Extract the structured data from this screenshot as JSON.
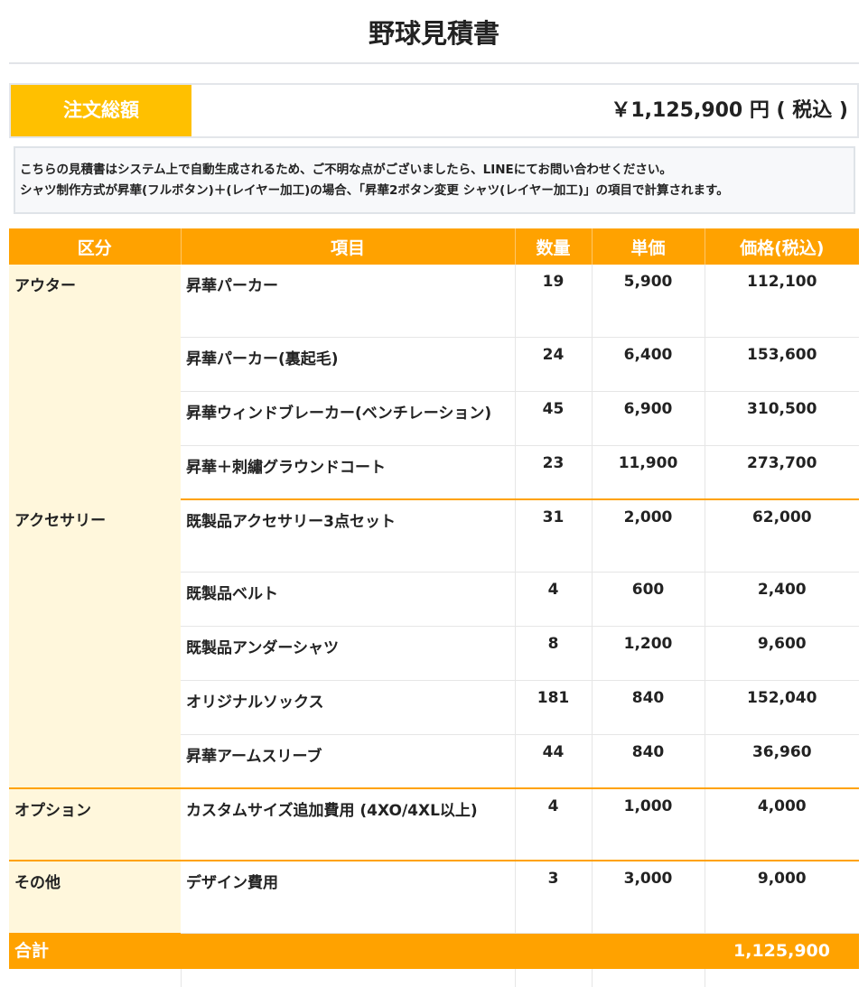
{
  "title": "野球見積書",
  "order_total": {
    "label": "注文総額",
    "value": "￥1,125,900 円 ( 税込 )"
  },
  "notice": {
    "line1": "こちらの見積書はシステム上で自動生成されるため、ご不明な点がございましたら、LINEにてお問い合わせください。",
    "line2": "シャツ制作方式が昇華(フルボタン)＋(レイヤー加工)の場合、「昇華2ボタン変更 シャツ(レイヤー加工)」の項目で計算されます。"
  },
  "table": {
    "headers": [
      "区分",
      "項目",
      "数量",
      "単価",
      "価格(税込)"
    ],
    "groups": [
      {
        "category": "アウター",
        "rows": [
          {
            "item": "昇華パーカー",
            "qty": "19",
            "unit": "5,900",
            "price": "112,100"
          },
          {
            "item": "昇華パーカー(裏起毛)",
            "qty": "24",
            "unit": "6,400",
            "price": "153,600"
          },
          {
            "item": "昇華ウィンドブレーカー(ベンチレーション)",
            "qty": "45",
            "unit": "6,900",
            "price": "310,500"
          },
          {
            "item": "昇華＋刺繡グラウンドコート",
            "qty": "23",
            "unit": "11,900",
            "price": "273,700"
          }
        ]
      },
      {
        "category": "アクセサリー",
        "rows": [
          {
            "item": "既製品アクセサリー3点セット",
            "qty": "31",
            "unit": "2,000",
            "price": "62,000"
          },
          {
            "item": "既製品ベルト",
            "qty": "4",
            "unit": "600",
            "price": "2,400"
          },
          {
            "item": "既製品アンダーシャツ",
            "qty": "8",
            "unit": "1,200",
            "price": "9,600"
          },
          {
            "item": "オリジナルソックス",
            "qty": "181",
            "unit": "840",
            "price": "152,040"
          },
          {
            "item": "昇華アームスリーブ",
            "qty": "44",
            "unit": "840",
            "price": "36,960"
          }
        ]
      },
      {
        "category": "オプション",
        "rows": [
          {
            "item": "カスタムサイズ追加費用 (4XO/4XL以上)",
            "qty": "4",
            "unit": "1,000",
            "price": "4,000"
          }
        ]
      },
      {
        "category": "その他",
        "rows": [
          {
            "item": "デザイン費用",
            "qty": "3",
            "unit": "3,000",
            "price": "9,000"
          }
        ]
      }
    ],
    "total": {
      "label": "合計",
      "value": "1,125,900"
    }
  }
}
